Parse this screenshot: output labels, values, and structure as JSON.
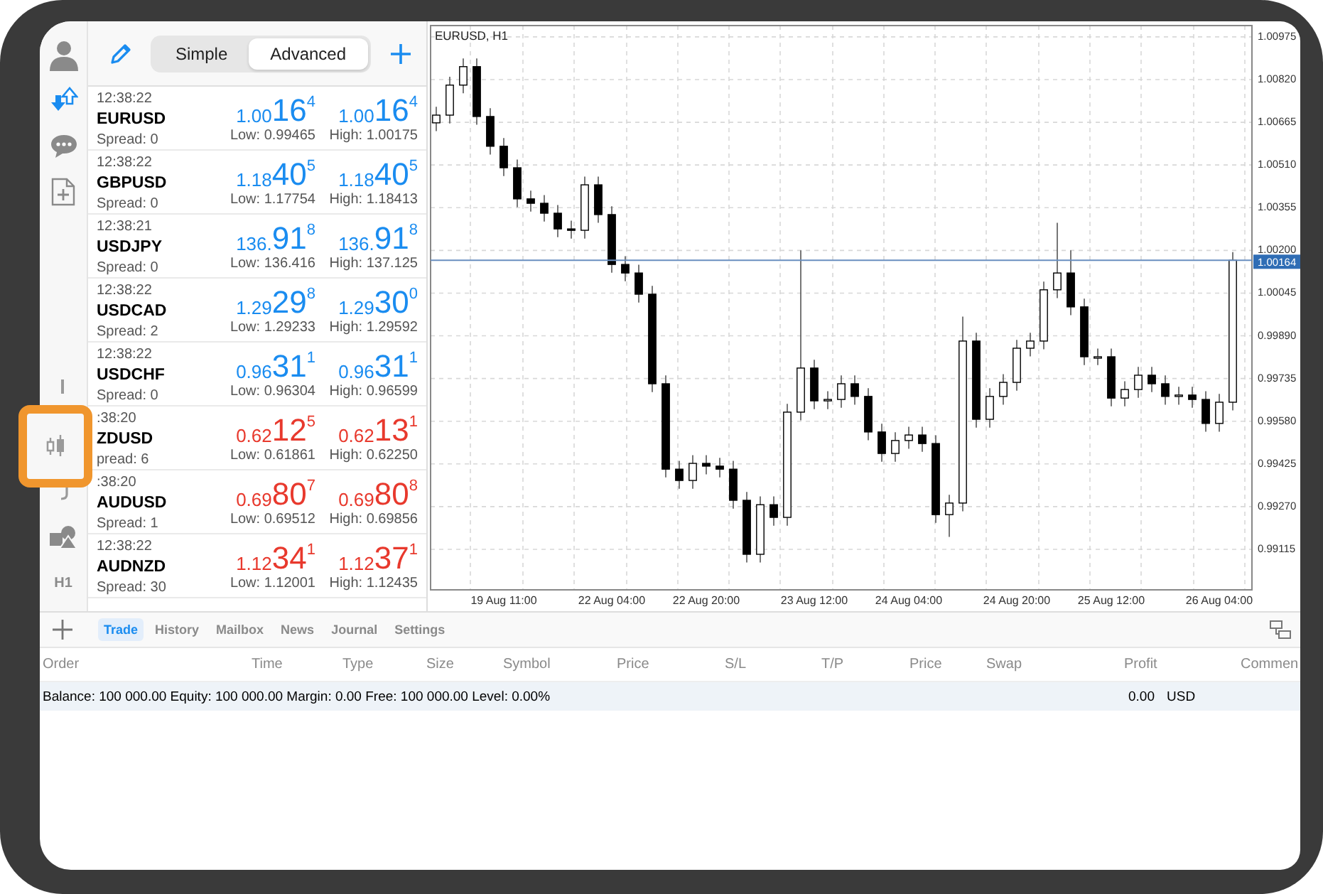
{
  "sidebar": {
    "items": [
      {
        "kind": "account",
        "selected": false
      },
      {
        "kind": "trade",
        "selected": true
      },
      {
        "kind": "chat",
        "selected": false
      },
      {
        "kind": "new",
        "selected": false
      },
      {
        "kind": "partial-top",
        "selected": false
      },
      {
        "kind": "candles",
        "selected": false
      },
      {
        "kind": "partial-bottom",
        "selected": false
      },
      {
        "kind": "objects",
        "selected": false
      },
      {
        "kind": "text",
        "label": "H1",
        "selected": false
      }
    ]
  },
  "highlight": {
    "on": true
  },
  "quotes_toolbar": {
    "modes": [
      {
        "label": "Simple",
        "selected": false
      },
      {
        "label": "Advanced",
        "selected": true
      }
    ]
  },
  "quotes": [
    {
      "time": "12:38:22",
      "symbol": "EURUSD",
      "spread": "Spread: 0",
      "color": "#1a8cf0",
      "bid": {
        "prefix": "1.00",
        "big": "16",
        "sup": "4"
      },
      "low": "Low: 0.99465",
      "ask": {
        "prefix": "1.00",
        "big": "16",
        "sup": "4"
      },
      "high": "High: 1.00175"
    },
    {
      "time": "12:38:22",
      "symbol": "GBPUSD",
      "spread": "Spread: 0",
      "color": "#1a8cf0",
      "bid": {
        "prefix": "1.18",
        "big": "40",
        "sup": "5"
      },
      "low": "Low: 1.17754",
      "ask": {
        "prefix": "1.18",
        "big": "40",
        "sup": "5"
      },
      "high": "High: 1.18413"
    },
    {
      "time": "12:38:21",
      "symbol": "USDJPY",
      "spread": "Spread: 0",
      "color": "#1a8cf0",
      "bid": {
        "prefix": "136.",
        "big": "91",
        "sup": "8"
      },
      "low": "Low: 136.416",
      "ask": {
        "prefix": "136.",
        "big": "91",
        "sup": "8"
      },
      "high": "High: 137.125"
    },
    {
      "time": "12:38:22",
      "symbol": "USDCAD",
      "spread": "Spread: 2",
      "color": "#1a8cf0",
      "bid": {
        "prefix": "1.29",
        "big": "29",
        "sup": "8"
      },
      "low": "Low: 1.29233",
      "ask": {
        "prefix": "1.29",
        "big": "30",
        "sup": "0"
      },
      "high": "High: 1.29592"
    },
    {
      "time": "12:38:22",
      "symbol": "USDCHF",
      "spread": "Spread: 0",
      "color": "#1a8cf0",
      "bid": {
        "prefix": "0.96",
        "big": "31",
        "sup": "1"
      },
      "low": "Low: 0.96304",
      "ask": {
        "prefix": "0.96",
        "big": "31",
        "sup": "1"
      },
      "high": "High: 0.96599"
    },
    {
      "time": ":38:20",
      "symbol": "ZDUSD",
      "spread": "pread: 6",
      "color": "#e8392d",
      "bid": {
        "prefix": "0.62",
        "big": "12",
        "sup": "5"
      },
      "low": "Low: 0.61861",
      "ask": {
        "prefix": "0.62",
        "big": "13",
        "sup": "1"
      },
      "high": "High: 0.62250"
    },
    {
      "time": ":38:20",
      "symbol": "AUDUSD",
      "spread": "Spread: 1",
      "color": "#e8392d",
      "bid": {
        "prefix": "0.69",
        "big": "80",
        "sup": "7"
      },
      "low": "Low: 0.69512",
      "ask": {
        "prefix": "0.69",
        "big": "80",
        "sup": "8"
      },
      "high": "High: 0.69856"
    },
    {
      "time": "12:38:22",
      "symbol": "AUDNZD",
      "spread": "Spread: 30",
      "color": "#e8392d",
      "bid": {
        "prefix": "1.12",
        "big": "34",
        "sup": "1"
      },
      "low": "Low: 1.12001",
      "ask": {
        "prefix": "1.12",
        "big": "37",
        "sup": "1"
      },
      "high": "High: 1.12435"
    }
  ],
  "chart": {
    "chart_data": {
      "type": "candlestick",
      "title": "EURUSD, H1",
      "grid": true,
      "ref_lines": [
        {
          "axis": "y",
          "value": 1.00164,
          "label": "1.00164"
        }
      ],
      "categories": [
        null,
        null,
        null,
        null,
        null,
        "19 Aug 11:00",
        null,
        null,
        null,
        null,
        null,
        null,
        null,
        "22 Aug 04:00",
        null,
        null,
        null,
        null,
        null,
        null,
        "22 Aug 20:00",
        null,
        null,
        null,
        null,
        null,
        null,
        null,
        "23 Aug 12:00",
        null,
        null,
        null,
        null,
        null,
        null,
        "24 Aug 04:00",
        null,
        null,
        null,
        null,
        null,
        null,
        null,
        "24 Aug 20:00",
        null,
        null,
        null,
        null,
        null,
        null,
        "25 Aug 12:00",
        null,
        null,
        null,
        null,
        null,
        null,
        null,
        "26 Aug 04:00",
        null
      ],
      "ohlc": [
        [
          1.00663,
          1.00721,
          1.00633,
          1.00691
        ],
        [
          1.00691,
          1.0083,
          1.00661,
          1.008
        ],
        [
          1.008,
          1.00897,
          1.0077,
          1.00867
        ],
        [
          1.00867,
          1.00897,
          1.00656,
          1.00686
        ],
        [
          1.00686,
          1.00716,
          1.00548,
          1.00578
        ],
        [
          1.00578,
          1.00608,
          1.0047,
          1.005
        ],
        [
          1.005,
          1.0053,
          1.00357,
          1.00387
        ],
        [
          1.00387,
          1.00417,
          1.00341,
          1.00371
        ],
        [
          1.00371,
          1.00401,
          1.00305,
          1.00335
        ],
        [
          1.00335,
          1.00365,
          1.00248,
          1.00278
        ],
        [
          1.00278,
          1.00308,
          1.00243,
          1.00273
        ],
        [
          1.00273,
          1.00468,
          1.00243,
          1.00438
        ],
        [
          1.00438,
          1.00468,
          1.003,
          1.0033
        ],
        [
          1.0033,
          1.0036,
          1.00119,
          1.00149
        ],
        [
          1.00149,
          1.00179,
          1.00088,
          1.00118
        ],
        [
          1.00118,
          1.00148,
          1.00011,
          1.00041
        ],
        [
          1.00041,
          1.00071,
          0.99686,
          0.99716
        ],
        [
          0.99716,
          0.99746,
          0.99376,
          0.99406
        ],
        [
          0.99406,
          0.99436,
          0.99335,
          0.99365
        ],
        [
          0.99365,
          0.99457,
          0.99335,
          0.99427
        ],
        [
          0.99427,
          0.99457,
          0.99387,
          0.99417
        ],
        [
          0.99417,
          0.99447,
          0.99376,
          0.99406
        ],
        [
          0.99406,
          0.99436,
          0.99263,
          0.99293
        ],
        [
          0.99293,
          0.99323,
          0.99067,
          0.99097
        ],
        [
          0.99097,
          0.99307,
          0.99067,
          0.99277
        ],
        [
          0.99277,
          0.99307,
          0.99201,
          0.99231
        ],
        [
          0.99231,
          0.99643,
          0.99201,
          0.99613
        ],
        [
          0.99613,
          1.002,
          0.99583,
          0.99773
        ],
        [
          0.99773,
          0.99803,
          0.99624,
          0.99654
        ],
        [
          0.99654,
          0.99689,
          0.99624,
          0.99659
        ],
        [
          0.99659,
          0.99746,
          0.99629,
          0.99716
        ],
        [
          0.99716,
          0.99746,
          0.9964,
          0.9967
        ],
        [
          0.9967,
          0.997,
          0.99511,
          0.99541
        ],
        [
          0.99541,
          0.99571,
          0.99433,
          0.99463
        ],
        [
          0.99463,
          0.9954,
          0.99433,
          0.9951
        ],
        [
          0.9951,
          0.9956,
          0.9948,
          0.9953
        ],
        [
          0.9953,
          0.9956,
          0.99469,
          0.99499
        ],
        [
          0.99499,
          0.99529,
          0.99211,
          0.99241
        ],
        [
          0.99241,
          0.99313,
          0.9916,
          0.99283
        ],
        [
          0.99283,
          0.9996,
          0.99253,
          0.99871
        ],
        [
          0.99871,
          0.99901,
          0.99557,
          0.99587
        ],
        [
          0.99587,
          0.997,
          0.99557,
          0.9967
        ],
        [
          0.9967,
          0.99751,
          0.9964,
          0.99721
        ],
        [
          0.99721,
          0.99875,
          0.99691,
          0.99845
        ],
        [
          0.99845,
          0.99901,
          0.99815,
          0.99871
        ],
        [
          0.99871,
          1.00087,
          0.99841,
          1.00057
        ],
        [
          1.00057,
          1.003,
          1.00027,
          1.00118
        ],
        [
          1.00118,
          1.002,
          0.99965,
          0.99995
        ],
        [
          0.99995,
          1.00025,
          0.99784,
          0.99814
        ],
        [
          0.99814,
          0.99844,
          0.99784,
          0.99814
        ],
        [
          0.99814,
          0.99844,
          0.99634,
          0.99664
        ],
        [
          0.99664,
          0.99725,
          0.99634,
          0.99695
        ],
        [
          0.99695,
          0.99777,
          0.99665,
          0.99747
        ],
        [
          0.99747,
          0.99777,
          0.99686,
          0.99716
        ],
        [
          0.99716,
          0.99746,
          0.9964,
          0.9967
        ],
        [
          0.9967,
          0.99705,
          0.9964,
          0.99675
        ],
        [
          0.99675,
          0.99705,
          0.99629,
          0.99659
        ],
        [
          0.99659,
          0.99689,
          0.99542,
          0.99572
        ],
        [
          0.99572,
          0.99679,
          0.99542,
          0.99649
        ],
        [
          0.99649,
          1.00194,
          0.99619,
          1.00164
        ]
      ],
      "ylim": [
        0.98968,
        1.01016
      ],
      "yticks": [
        {
          "value": 1.00975,
          "label": "1.00975"
        },
        {
          "value": 1.0082,
          "label": "1.00820"
        },
        {
          "value": 1.00665,
          "label": "1.00665"
        },
        {
          "value": 1.0051,
          "label": "1.00510"
        },
        {
          "value": 1.00355,
          "label": "1.00355"
        },
        {
          "value": 1.002,
          "label": "1.00200"
        },
        {
          "value": 1.00045,
          "label": "1.00045"
        },
        {
          "value": 0.9989,
          "label": "0.99890"
        },
        {
          "value": 0.99735,
          "label": "0.99735"
        },
        {
          "value": 0.9958,
          "label": "0.99580"
        },
        {
          "value": 0.99425,
          "label": "0.99425"
        },
        {
          "value": 0.9927,
          "label": "0.99270"
        },
        {
          "value": 0.99115,
          "label": "0.99115"
        }
      ]
    }
  },
  "terminal": {
    "tabs": [
      {
        "label": "Trade",
        "selected": true
      },
      {
        "label": "History",
        "selected": false
      },
      {
        "label": "Mailbox",
        "selected": false
      },
      {
        "label": "News",
        "selected": false
      },
      {
        "label": "Journal",
        "selected": false
      },
      {
        "label": "Settings",
        "selected": false
      }
    ],
    "columns": [
      "Order",
      "Time",
      "Type",
      "Size",
      "Symbol",
      "Price",
      "S/L",
      "T/P",
      "Price",
      "Swap",
      "Profit",
      "Commen"
    ],
    "summary": "Balance: 100 000.00 Equity: 100 000.00 Margin: 0.00 Free: 100 000.00 Level: 0.00%",
    "profit": "0.00",
    "currency": "USD"
  }
}
